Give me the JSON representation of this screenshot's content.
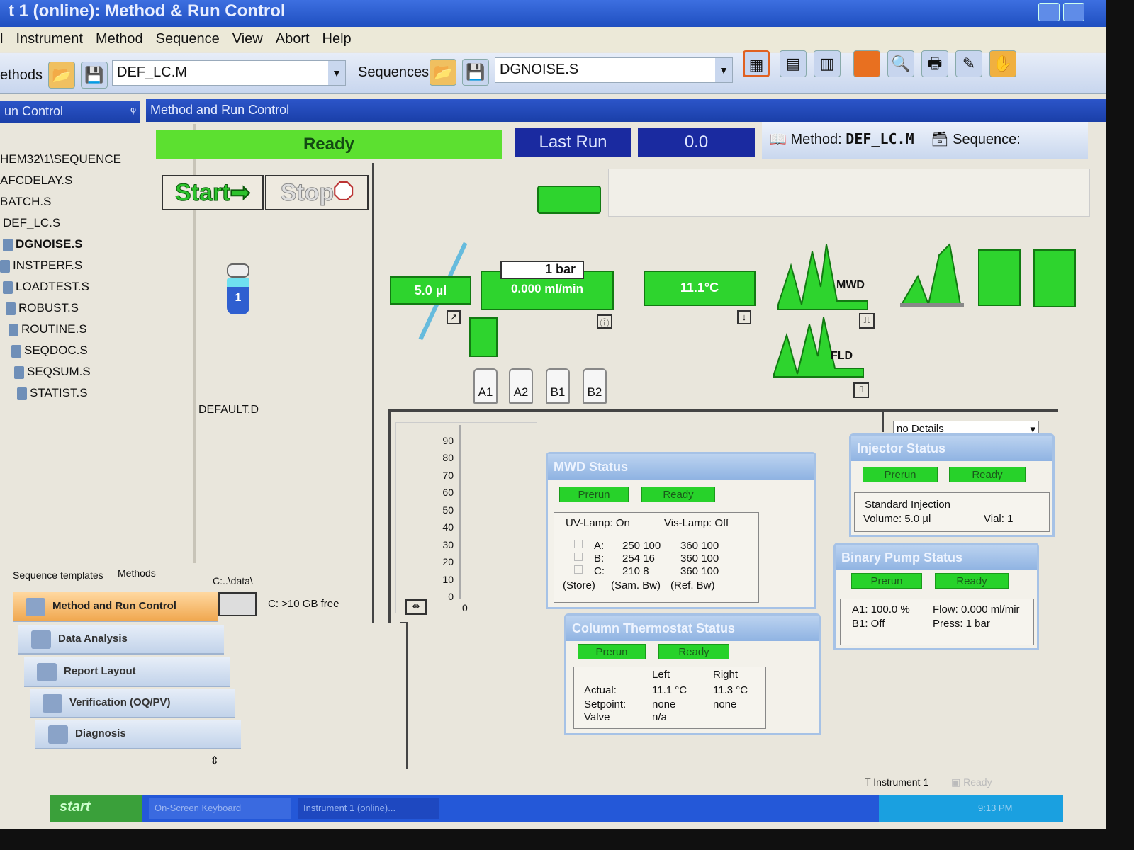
{
  "window": {
    "title": "t 1 (online): Method & Run Control"
  },
  "menu": [
    "l",
    "Instrument",
    "Method",
    "Sequence",
    "View",
    "Abort",
    "Help"
  ],
  "toolbar": {
    "methods_label": "ethods",
    "method_value": "DEF_LC.M",
    "sequences_label": "Sequences",
    "sequence_value": "DGNOISE.S",
    "icons": [
      "layout-icon",
      "layout2-icon",
      "layout3-icon",
      "book-icon",
      "preview-icon",
      "print-icon",
      "edit-icon",
      "hand-icon"
    ]
  },
  "left_panel": {
    "title": "un Control",
    "path": "HEM32\\1\\SEQUENCE",
    "files": [
      "AFCDELAY.S",
      "BATCH.S",
      "DEF_LC.S",
      "DGNOISE.S",
      "INSTPERF.S",
      "LOADTEST.S",
      "ROBUST.S",
      "ROUTINE.S",
      "SEQDOC.S",
      "SEQSUM.S",
      "STATIST.S"
    ],
    "selected": "DGNOISE.S",
    "tabs": [
      "Sequence templates",
      "Methods"
    ],
    "nav": [
      "Method and Run Control",
      "Data Analysis",
      "Report Layout",
      "Verification (OQ/PV)",
      "Diagnosis"
    ],
    "active_nav": "Method and Run Control"
  },
  "main": {
    "title": "Method and Run Control",
    "status": "Ready",
    "last_run_label": "Last Run",
    "last_run_value": "0.0",
    "method_label": "Method:",
    "method_value": "DEF_LC.M",
    "sequence_label": "Sequence:",
    "start_label": "Start",
    "stop_label": "Stop",
    "vial_number": "1",
    "data_file": "DEFAULT.D",
    "data_path": "C:..\\data\\",
    "disk_free": "C: >10 GB free"
  },
  "schematic": {
    "injector_volume": "5.0 µl",
    "pump_pressure": "1 bar",
    "pump_flow": "0.000 ml/min",
    "column_temp": "11.1°C",
    "mwd_label": "MWD",
    "fld_label": "FLD",
    "bottles": [
      "A1",
      "A2",
      "B1",
      "B2"
    ]
  },
  "chart_data": {
    "type": "line",
    "y_ticks": [
      "90",
      "80",
      "70",
      "60",
      "50",
      "40",
      "30",
      "20",
      "10",
      "0"
    ],
    "x_ticks": [
      "0"
    ],
    "ylim": [
      0,
      90
    ],
    "series": []
  },
  "details_select": "no Details",
  "mwd_status": {
    "title": "MWD Status",
    "prerun": "Prerun",
    "ready": "Ready",
    "uv_lamp": "UV-Lamp: On",
    "vis_lamp": "Vis-Lamp:  Off",
    "rows": [
      [
        "A:",
        "250 100",
        "360 100"
      ],
      [
        "B:",
        "254 16",
        "360 100"
      ],
      [
        "C:",
        "210 8",
        "360 100"
      ]
    ],
    "footer": [
      "(Store)",
      "(Sam. Bw)",
      "(Ref. Bw)"
    ]
  },
  "injector_status": {
    "title": "Injector Status",
    "prerun": "Prerun",
    "ready": "Ready",
    "mode": "Standard Injection",
    "volume": "Volume:  5.0 µl",
    "vial": "Vial:  1"
  },
  "pump_status": {
    "title": "Binary Pump Status",
    "prerun": "Prerun",
    "ready": "Ready",
    "a1": "A1:  100.0 %",
    "b1": "B1:     Off",
    "flow": "Flow:   0.000 ml/mir",
    "press": "Press:         1 bar"
  },
  "thermostat_status": {
    "title": "Column Thermostat Status",
    "prerun": "Prerun",
    "ready": "Ready",
    "left": "Left",
    "right": "Right",
    "labels": [
      "Actual:",
      "Setpoint:",
      "Valve"
    ],
    "left_vals": [
      "11.1 °C",
      "none",
      "n/a"
    ],
    "right_vals": [
      "11.3 °C",
      "none"
    ]
  },
  "statusbar": {
    "instrument": "Instrument 1",
    "state": "Ready"
  },
  "taskbar": {
    "start": "start",
    "items": [
      "On-Screen Keyboard",
      "Instrument 1 (online)..."
    ],
    "clock": "9:13 PM"
  },
  "colors": {
    "ready_green": "#5ce030",
    "titlebar_blue": "#2a56c6",
    "lastrun_blue": "#1a2aa0",
    "prerun_green": "#27d22a"
  }
}
